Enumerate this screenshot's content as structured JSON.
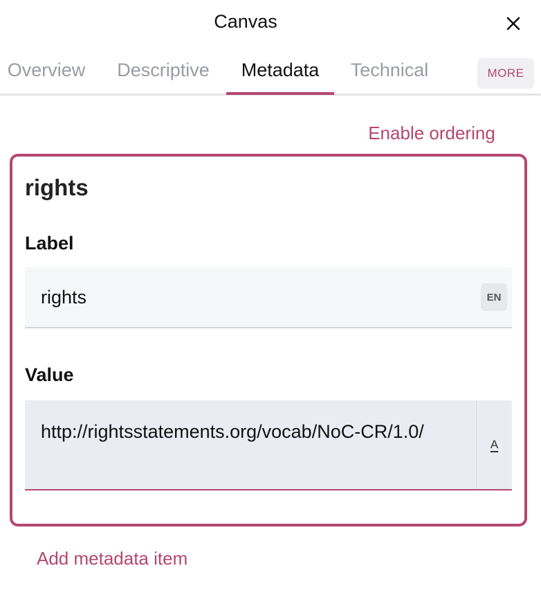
{
  "header": {
    "title": "Canvas",
    "close_icon": "close-icon"
  },
  "tabs": [
    {
      "label": "Overview",
      "active": false
    },
    {
      "label": "Descriptive",
      "active": false
    },
    {
      "label": "Metadata",
      "active": true
    },
    {
      "label": "Technical",
      "active": false
    }
  ],
  "more_label": "MORE",
  "enable_ordering_label": "Enable ordering",
  "metadata_item": {
    "title": "rights",
    "label_heading": "Label",
    "label_value": "rights",
    "label_language": "EN",
    "value_heading": "Value",
    "value_text": "http://rightsstatements.org/vocab/NoC-CR/1.0/",
    "value_format_glyph": "A"
  },
  "add_item_label": "Add metadata item",
  "colors": {
    "accent": "#b5476f",
    "muted_tab": "#9a9ca4"
  }
}
